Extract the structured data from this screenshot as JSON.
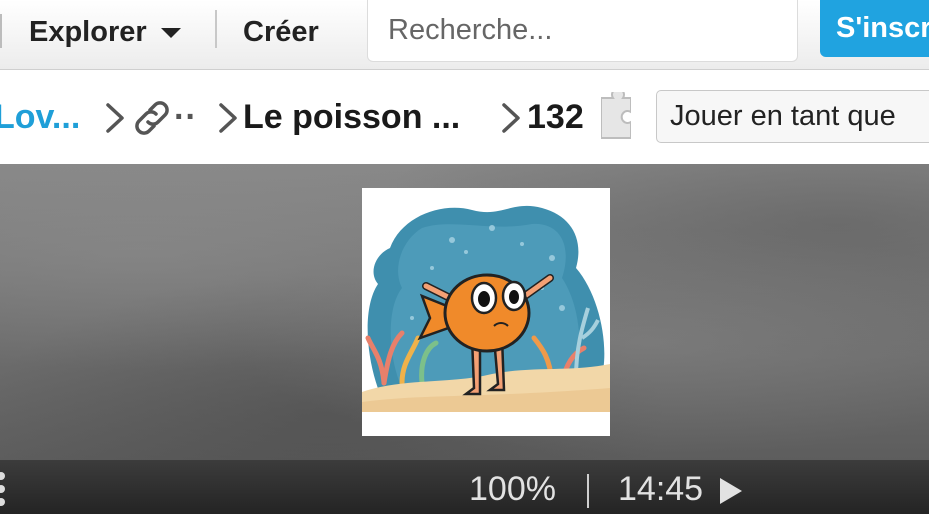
{
  "nav": {
    "explore_label": "Explorer",
    "create_label": "Créer",
    "search_placeholder": "Recherche...",
    "signup_label": "S'inscr"
  },
  "breadcrumb": {
    "user": "Lov...",
    "collection": "··",
    "title": "Le poisson ...",
    "piece_count": "132"
  },
  "play_as": {
    "label": "Jouer en tant que"
  },
  "footer": {
    "zoom": "100%",
    "separator": "|",
    "timer": "14:45"
  },
  "colors": {
    "accent": "#20a3e0",
    "link": "#1f9fd8"
  },
  "icons": [
    "caret-down-icon",
    "chevron-right-icon",
    "link-icon",
    "puzzle-piece-icon",
    "menu-dots-icon",
    "play-icon"
  ]
}
